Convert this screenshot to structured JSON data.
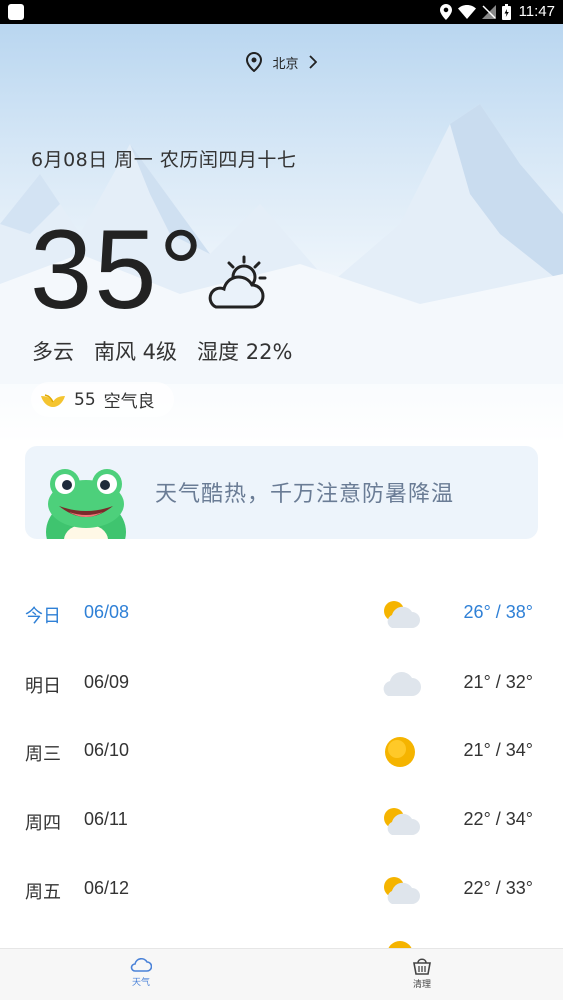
{
  "status_bar": {
    "time": "11:47"
  },
  "location": {
    "city": "北京"
  },
  "date_line": "6月08日  周一  农历闰四月十七",
  "current": {
    "temperature": "35°",
    "condition": "多云",
    "wind": "南风 4级",
    "humidity": "湿度 22%",
    "condition_icon": "partly-cloudy-icon"
  },
  "aqi": {
    "value": "55",
    "label": "空气良",
    "icon": "aqi-leaf-icon"
  },
  "tip": {
    "text": "天气酷热，千万注意防暑降温",
    "mascot": "frog-mascot"
  },
  "forecast": [
    {
      "day": "今日",
      "date": "06/08",
      "icon": "partly-cloudy-icon",
      "range": "26° /  38°"
    },
    {
      "day": "明日",
      "date": "06/09",
      "icon": "cloudy-icon",
      "range": "21° /  32°"
    },
    {
      "day": "周三",
      "date": "06/10",
      "icon": "sunny-icon",
      "range": "21° /  34°"
    },
    {
      "day": "周四",
      "date": "06/11",
      "icon": "partly-cloudy-icon",
      "range": "22° /  34°"
    },
    {
      "day": "周五",
      "date": "06/12",
      "icon": "partly-cloudy-icon",
      "range": "22° /  33°"
    }
  ],
  "tabs": [
    {
      "label": "天气",
      "icon": "cloud-tab-icon",
      "active": true
    },
    {
      "label": "清理",
      "icon": "broom-basket-icon",
      "active": false
    }
  ],
  "colors": {
    "accent": "#2f80d6",
    "tab_active": "#4a82d8",
    "tip_text": "#6a7c95",
    "sun": "#f5b400"
  }
}
